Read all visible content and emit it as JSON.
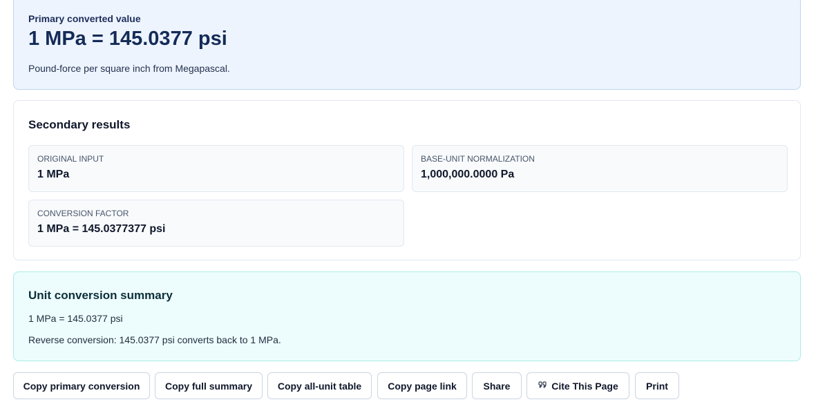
{
  "primary": {
    "label": "Primary converted value",
    "value": "1 MPa = 145.0377 psi",
    "description": "Pound-force per square inch from Megapascal."
  },
  "secondary": {
    "title": "Secondary results",
    "items": [
      {
        "label": "ORIGINAL INPUT",
        "value": "1 MPa"
      },
      {
        "label": "BASE-UNIT NORMALIZATION",
        "value": "1,000,000.0000 Pa"
      },
      {
        "label": "CONVERSION FACTOR",
        "value": "1 MPa = 145.0377377 psi"
      }
    ]
  },
  "summary": {
    "title": "Unit conversion summary",
    "line1": "1 MPa = 145.0377 psi",
    "line2": "Reverse conversion: 145.0377 psi converts back to 1 MPa."
  },
  "actions": {
    "copy_primary": "Copy primary conversion",
    "copy_summary": "Copy full summary",
    "copy_table": "Copy all-unit table",
    "copy_link": "Copy page link",
    "share": "Share",
    "cite": "Cite This Page",
    "cite_icon": "quote-icon",
    "print": "Print"
  }
}
